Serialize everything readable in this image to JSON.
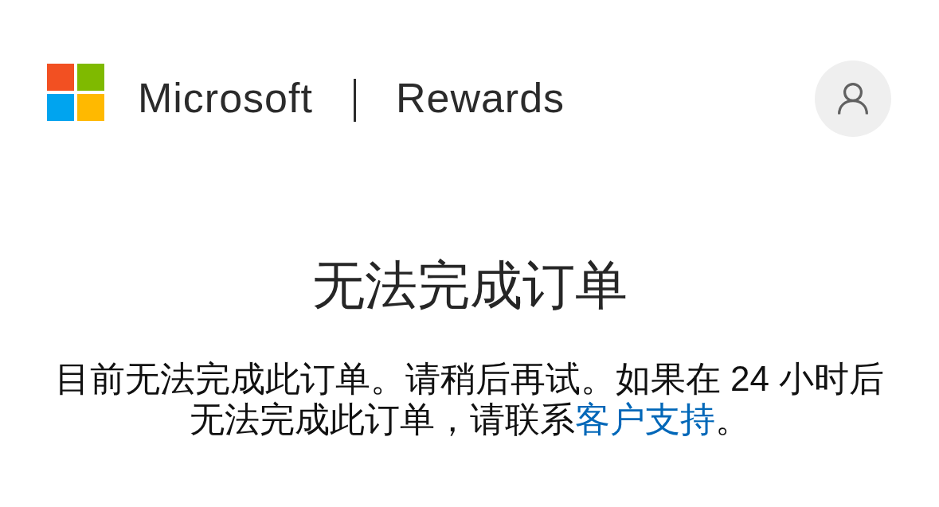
{
  "header": {
    "brand": "Microsoft",
    "product": "Rewards"
  },
  "error": {
    "title": "无法完成订单",
    "message_before": "目前无法完成此订单。请稍后再试。如果在 24 小时后无法完成此订单，请联系",
    "support_link": "客户支持",
    "message_after": "。"
  }
}
